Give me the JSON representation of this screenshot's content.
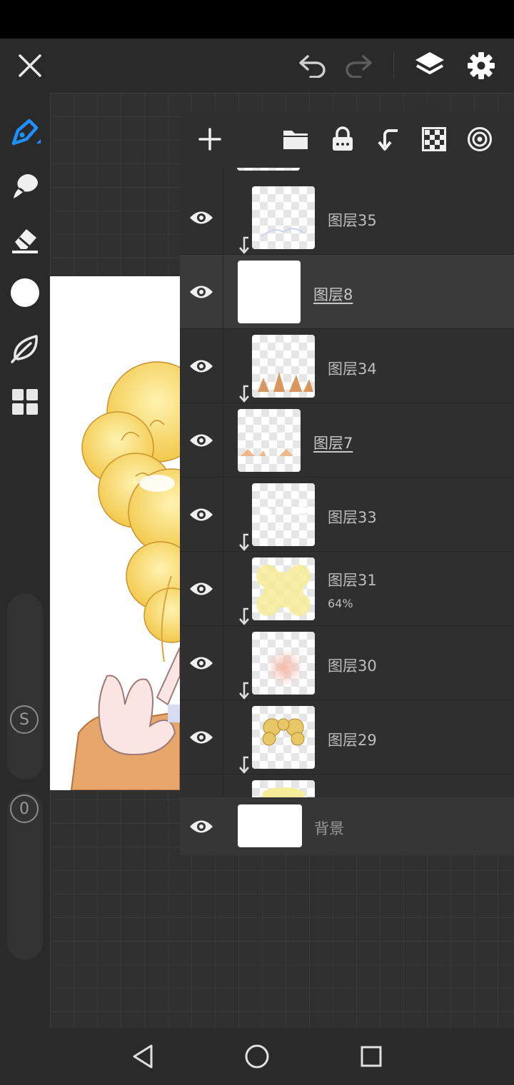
{
  "top_bar": {
    "close": "close-icon",
    "undo": "undo-icon",
    "redo": "redo-icon",
    "layers": "layers-icon",
    "settings": "gear-icon"
  },
  "tools": [
    "pen-icon",
    "smudge-icon",
    "eraser-icon",
    "color-swatch",
    "leaf-icon",
    "grid-icon"
  ],
  "sliders": {
    "size_badge": "S",
    "opacity_badge": "0"
  },
  "layer_panel": {
    "toolbar": [
      "add-icon",
      "folder-icon",
      "lock-icon",
      "clip-icon",
      "transparency-icon",
      "target-icon"
    ],
    "layers": [
      {
        "name": "图层35",
        "opacity": "",
        "clipped": true,
        "selected": false
      },
      {
        "name": "图层8",
        "opacity": "",
        "clipped": false,
        "selected": true
      },
      {
        "name": "图层34",
        "opacity": "",
        "clipped": true,
        "selected": false
      },
      {
        "name": "图层7",
        "opacity": "",
        "clipped": false,
        "selected": false
      },
      {
        "name": "图层33",
        "opacity": "",
        "clipped": true,
        "selected": false
      },
      {
        "name": "图层31",
        "opacity": "64%",
        "clipped": true,
        "selected": false
      },
      {
        "name": "图层30",
        "opacity": "",
        "clipped": true,
        "selected": false
      },
      {
        "name": "图层29",
        "opacity": "",
        "clipped": true,
        "selected": false
      }
    ],
    "background_layer": "背景"
  },
  "colors": {
    "accent": "#1e90ff",
    "panel": "#2f2f2f",
    "current_color": "#ffffff"
  }
}
